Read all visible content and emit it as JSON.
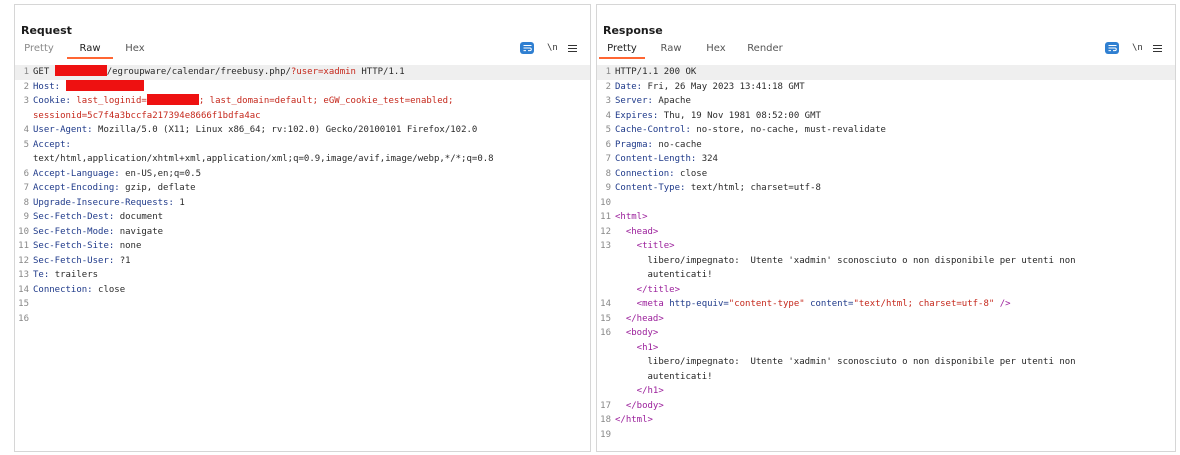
{
  "colors": {
    "accent": "#ff6633",
    "button_blue": "#2f7fd1",
    "redaction": "#ee1111"
  },
  "layout_toggle": {
    "icons": [
      "side-by-side-icon",
      "stacked-icon",
      "single-pane-icon"
    ],
    "active": 0
  },
  "request": {
    "title": "Request",
    "tabs": [
      {
        "label": "Pretty",
        "active": false
      },
      {
        "label": "Raw",
        "active": true
      },
      {
        "label": "Hex",
        "active": false
      }
    ],
    "tools": {
      "wrap_icon": "text-wrap-icon",
      "newline_label": "\\n",
      "menu_icon": "menu-icon"
    },
    "lines": [
      {
        "n": "1",
        "hl": true,
        "parts": [
          {
            "t": "GET ",
            "c": "sv"
          },
          {
            "redact": 52
          },
          {
            "t": "/egroupware/calendar/freebusy.php/",
            "c": "sv"
          },
          {
            "t": "?user=xadmin",
            "c": "red"
          },
          {
            "t": " HTTP/1.1",
            "c": "sv"
          }
        ]
      },
      {
        "n": "2",
        "parts": [
          {
            "t": "Host: ",
            "c": "hn"
          },
          {
            "redact": 78
          }
        ]
      },
      {
        "n": "3",
        "parts": [
          {
            "t": "Cookie: ",
            "c": "hn"
          },
          {
            "t": "last_loginid=",
            "c": "red"
          },
          {
            "redact": 52
          },
          {
            "t": "; last_domain=default; eGW_cookie_test=enabled;",
            "c": "red"
          }
        ]
      },
      {
        "n": "",
        "parts": [
          {
            "t": "sessionid=5c7f4a3bccfa217394e8666f1bdfa4ac",
            "c": "red"
          }
        ]
      },
      {
        "n": "4",
        "parts": [
          {
            "t": "User-Agent: ",
            "c": "hn"
          },
          {
            "t": "Mozilla/5.0 (X11; Linux x86_64; rv:102.0) Gecko/20100101 Firefox/102.0",
            "c": "sv"
          }
        ]
      },
      {
        "n": "5",
        "parts": [
          {
            "t": "Accept:",
            "c": "hn"
          }
        ]
      },
      {
        "n": "",
        "parts": [
          {
            "t": "text/html,application/xhtml+xml,application/xml;q=0.9,image/avif,image/webp,*/*;q=0.8",
            "c": "sv"
          }
        ]
      },
      {
        "n": "6",
        "parts": [
          {
            "t": "Accept-Language: ",
            "c": "hn"
          },
          {
            "t": "en-US,en;q=0.5",
            "c": "sv"
          }
        ]
      },
      {
        "n": "7",
        "parts": [
          {
            "t": "Accept-Encoding: ",
            "c": "hn"
          },
          {
            "t": "gzip, deflate",
            "c": "sv"
          }
        ]
      },
      {
        "n": "8",
        "parts": [
          {
            "t": "Upgrade-Insecure-Requests: ",
            "c": "hn"
          },
          {
            "t": "1",
            "c": "sv"
          }
        ]
      },
      {
        "n": "9",
        "parts": [
          {
            "t": "Sec-Fetch-Dest: ",
            "c": "hn"
          },
          {
            "t": "document",
            "c": "sv"
          }
        ]
      },
      {
        "n": "10",
        "parts": [
          {
            "t": "Sec-Fetch-Mode: ",
            "c": "hn"
          },
          {
            "t": "navigate",
            "c": "sv"
          }
        ]
      },
      {
        "n": "11",
        "parts": [
          {
            "t": "Sec-Fetch-Site: ",
            "c": "hn"
          },
          {
            "t": "none",
            "c": "sv"
          }
        ]
      },
      {
        "n": "12",
        "parts": [
          {
            "t": "Sec-Fetch-User: ",
            "c": "hn"
          },
          {
            "t": "?1",
            "c": "sv"
          }
        ]
      },
      {
        "n": "13",
        "parts": [
          {
            "t": "Te: ",
            "c": "hn"
          },
          {
            "t": "trailers",
            "c": "sv"
          }
        ]
      },
      {
        "n": "14",
        "parts": [
          {
            "t": "Connection: ",
            "c": "hn"
          },
          {
            "t": "close",
            "c": "sv"
          }
        ]
      },
      {
        "n": "15",
        "parts": []
      },
      {
        "n": "16",
        "parts": []
      }
    ]
  },
  "response": {
    "title": "Response",
    "tabs": [
      {
        "label": "Pretty",
        "active": true
      },
      {
        "label": "Raw",
        "active": false
      },
      {
        "label": "Hex",
        "active": false
      },
      {
        "label": "Render",
        "active": false
      }
    ],
    "tools": {
      "wrap_icon": "text-wrap-icon",
      "newline_label": "\\n",
      "menu_icon": "menu-icon"
    },
    "lines": [
      {
        "n": "1",
        "hl": true,
        "parts": [
          {
            "t": "HTTP/1.1 200 OK",
            "c": "sv"
          }
        ]
      },
      {
        "n": "2",
        "parts": [
          {
            "t": "Date: ",
            "c": "hn"
          },
          {
            "t": "Fri, 26 May 2023 13:41:18 GMT",
            "c": "sv"
          }
        ]
      },
      {
        "n": "3",
        "parts": [
          {
            "t": "Server: ",
            "c": "hn"
          },
          {
            "t": "Apache",
            "c": "sv"
          }
        ]
      },
      {
        "n": "4",
        "parts": [
          {
            "t": "Expires: ",
            "c": "hn"
          },
          {
            "t": "Thu, 19 Nov 1981 08:52:00 GMT",
            "c": "sv"
          }
        ]
      },
      {
        "n": "5",
        "parts": [
          {
            "t": "Cache-Control: ",
            "c": "hn"
          },
          {
            "t": "no-store, no-cache, must-revalidate",
            "c": "sv"
          }
        ]
      },
      {
        "n": "6",
        "parts": [
          {
            "t": "Pragma: ",
            "c": "hn"
          },
          {
            "t": "no-cache",
            "c": "sv"
          }
        ]
      },
      {
        "n": "7",
        "parts": [
          {
            "t": "Content-Length: ",
            "c": "hn"
          },
          {
            "t": "324",
            "c": "sv"
          }
        ]
      },
      {
        "n": "8",
        "parts": [
          {
            "t": "Connection: ",
            "c": "hn"
          },
          {
            "t": "close",
            "c": "sv"
          }
        ]
      },
      {
        "n": "9",
        "parts": [
          {
            "t": "Content-Type: ",
            "c": "hn"
          },
          {
            "t": "text/html; charset=utf-8",
            "c": "sv"
          }
        ]
      },
      {
        "n": "10",
        "parts": []
      },
      {
        "n": "11",
        "parts": [
          {
            "t": "<html>",
            "c": "tg"
          }
        ]
      },
      {
        "n": "12",
        "parts": [
          {
            "t": "  <head>",
            "c": "tg"
          }
        ]
      },
      {
        "n": "13",
        "parts": [
          {
            "t": "    <title>",
            "c": "tg"
          }
        ]
      },
      {
        "n": "",
        "parts": [
          {
            "t": "      libero/impegnato:  Utente 'xadmin' sconosciuto o non disponibile per utenti non",
            "c": "tx"
          }
        ]
      },
      {
        "n": "",
        "parts": [
          {
            "t": "      autenticati!",
            "c": "tx"
          }
        ]
      },
      {
        "n": "",
        "parts": [
          {
            "t": "    </title>",
            "c": "tg"
          }
        ]
      },
      {
        "n": "14",
        "parts": [
          {
            "t": "    <meta ",
            "c": "tg"
          },
          {
            "t": "http-equiv=",
            "c": "at"
          },
          {
            "t": "\"content-type\" ",
            "c": "av"
          },
          {
            "t": "content=",
            "c": "at"
          },
          {
            "t": "\"text/html; charset=utf-8\"",
            "c": "av"
          },
          {
            "t": " />",
            "c": "tg"
          }
        ]
      },
      {
        "n": "15",
        "parts": [
          {
            "t": "  </head>",
            "c": "tg"
          }
        ]
      },
      {
        "n": "16",
        "parts": [
          {
            "t": "  <body>",
            "c": "tg"
          }
        ]
      },
      {
        "n": "",
        "parts": [
          {
            "t": "    <h1>",
            "c": "tg"
          }
        ]
      },
      {
        "n": "",
        "parts": [
          {
            "t": "      libero/impegnato:  Utente 'xadmin' sconosciuto o non disponibile per utenti non",
            "c": "tx"
          }
        ]
      },
      {
        "n": "",
        "parts": [
          {
            "t": "      autenticati!",
            "c": "tx"
          }
        ]
      },
      {
        "n": "",
        "parts": [
          {
            "t": "    </h1>",
            "c": "tg"
          }
        ]
      },
      {
        "n": "17",
        "parts": [
          {
            "t": "  </body>",
            "c": "tg"
          }
        ]
      },
      {
        "n": "18",
        "parts": [
          {
            "t": "</html>",
            "c": "tg"
          }
        ]
      },
      {
        "n": "19",
        "parts": []
      }
    ]
  }
}
